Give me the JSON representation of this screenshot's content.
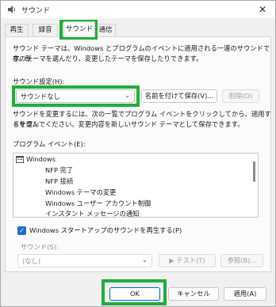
{
  "window": {
    "title": "サウンド",
    "close_glyph": "✕"
  },
  "tabs": [
    {
      "label": "再生"
    },
    {
      "label": "録音"
    },
    {
      "label": "サウンド"
    },
    {
      "label": "通信"
    }
  ],
  "description": {
    "line1": "サウンド テーマは、Windows とプログラムのイベントに適用される一連のサウンドです。既",
    "line2": "存のテーマを選んだり、変更したテーマを保存したりできます。"
  },
  "scheme": {
    "label": "サウンド設定(H):",
    "value": "サウンドなし",
    "save_as_label": "名前を付けて保存(V)...",
    "delete_label": "削除(D)"
  },
  "instructions": {
    "line1": "サウンドを変更するには、次の一覧でプログラム イベントをクリックしてから、適用するサウン",
    "line2": "ドを選んでください。変更内容を新しいサウンド テーマとして保存できます。"
  },
  "events": {
    "label": "プログラム イベント(E):",
    "group": "Windows",
    "items": [
      "NFP 完了",
      "NFP 接続",
      "Windows テーマの変更",
      "Windows ユーザー アカウント制御",
      "インスタント メッセージの通知"
    ]
  },
  "startup": {
    "label": "Windows スタートアップのサウンドを再生する(P)",
    "checked": true
  },
  "sound": {
    "label": "サウンド(S):",
    "value": "(なし)",
    "test_label": "▶ テスト(T)",
    "browse_label": "参照(B)..."
  },
  "footer": {
    "ok_label": "OK",
    "cancel_label": "キャンセル",
    "apply_label": "適用(A)"
  },
  "colors": {
    "highlight": "#1fae3a",
    "checkbox": "#1f6fbf"
  }
}
